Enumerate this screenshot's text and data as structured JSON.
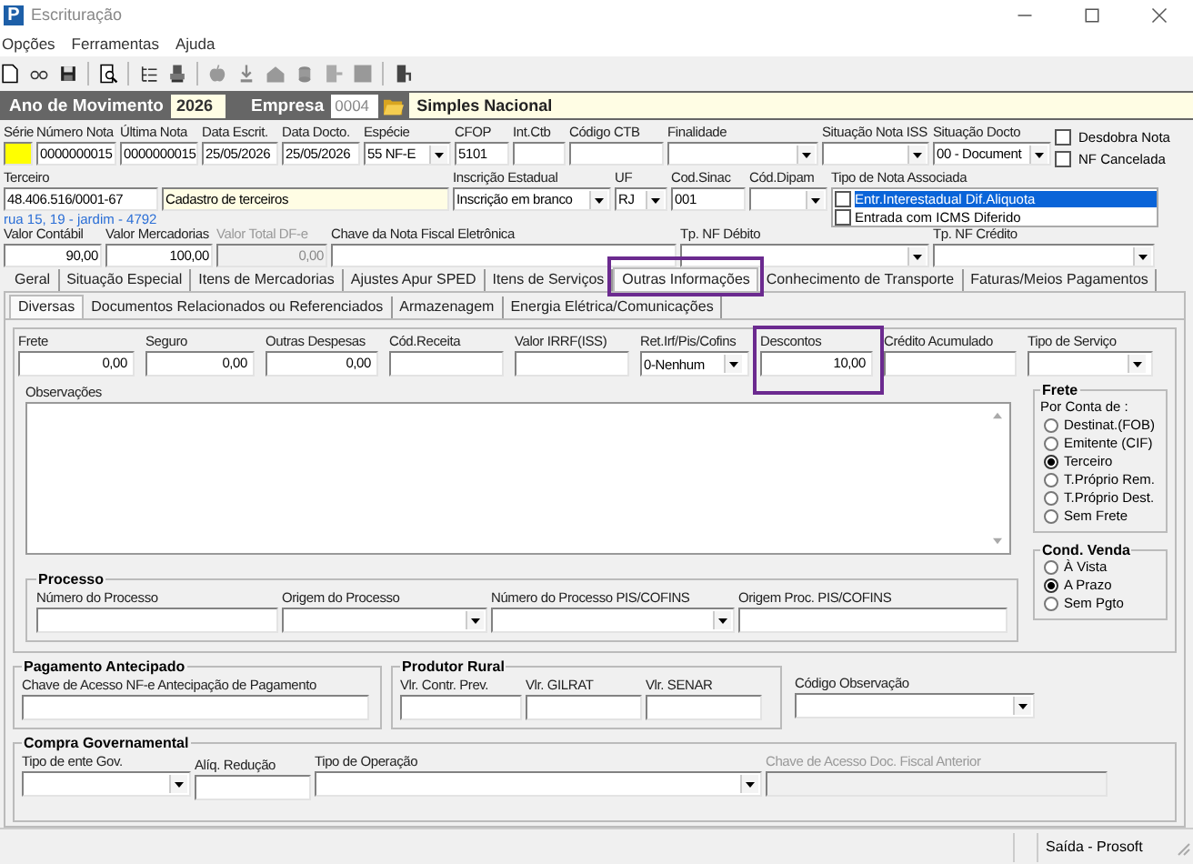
{
  "window": {
    "app_icon": "P",
    "title": "Escrituração"
  },
  "menu": [
    "Opções",
    "Ferramentas",
    "Ajuda"
  ],
  "year_bar": {
    "year_label": "Ano de Movimento",
    "year": "2026",
    "company_label": "Empresa",
    "company_code": "0004",
    "company_name": "Simples Nacional"
  },
  "header_row_1": [
    {
      "label": "Série",
      "kind": "swatch"
    },
    {
      "label": "Número Nota",
      "value": "0000000015",
      "kind": "text"
    },
    {
      "label": "Última Nota",
      "value": "0000000015",
      "kind": "text"
    },
    {
      "label": "Data Escrit.",
      "value": "25/05/2026",
      "kind": "text"
    },
    {
      "label": "Data Docto.",
      "value": "25/05/2026",
      "kind": "text"
    },
    {
      "label": "Espécie",
      "value": "55   NF-E",
      "kind": "dropdown"
    },
    {
      "label": "CFOP",
      "value": "5101",
      "kind": "text"
    },
    {
      "label": "Int.Ctb",
      "kind": "text"
    },
    {
      "label": "Código CTB",
      "kind": "text"
    },
    {
      "label": "Finalidade",
      "kind": "dropdown"
    },
    {
      "label": "Situação Nota ISS",
      "kind": "dropdown"
    },
    {
      "label": "Situação Docto",
      "value": "00 - Document",
      "kind": "dropdown"
    }
  ],
  "header_checks": [
    {
      "label": "Desdobra Nota",
      "checked": false
    },
    {
      "label": "NF Cancelada",
      "checked": false
    }
  ],
  "header_row_2": [
    {
      "label": "Terceiro",
      "value": "48.406.516/0001-67",
      "kind": "text"
    },
    {
      "value": "Cadastro de terceiros",
      "kind": "info"
    },
    {
      "label": "Inscrição Estadual",
      "value": "Inscrição em branco",
      "kind": "dropdown"
    },
    {
      "label": "UF",
      "value": "RJ",
      "kind": "dropdown"
    },
    {
      "label": "Cod.Sinac",
      "value": "001",
      "kind": "text"
    },
    {
      "label": "Cód.Dipam",
      "kind": "dropdown"
    }
  ],
  "associated_note_type": {
    "label": "Tipo de Nota Associada",
    "items": [
      {
        "label": "Entr.Interestadual Dif.Aliquota",
        "checked": false,
        "selected": true
      },
      {
        "label": "Entrada com ICMS Diferido",
        "checked": false,
        "selected": false
      }
    ]
  },
  "address": "rua 15, 19 - jardim - 4792",
  "header_row_3": [
    {
      "label": "Valor Contábil",
      "value": "90,00",
      "kind": "number",
      "disabled": false
    },
    {
      "label": "Valor Mercadorias",
      "value": "100,00",
      "kind": "number",
      "disabled": false
    },
    {
      "label": "Valor Total DF-e",
      "value": "0,00",
      "kind": "number",
      "disabled": true
    },
    {
      "label": "Chave da Nota Fiscal Eletrônica",
      "kind": "text",
      "disabled": false
    },
    {
      "label": "Tp. NF Débito",
      "kind": "dropdown",
      "disabled": false
    },
    {
      "label": "Tp. NF Crédito",
      "kind": "dropdown",
      "disabled": false
    }
  ],
  "tabs": [
    {
      "label": "Geral",
      "selected": false,
      "highlighted": false
    },
    {
      "label": "Situação Especial",
      "selected": false,
      "highlighted": false
    },
    {
      "label": "Itens de Mercadorias",
      "selected": false,
      "highlighted": false
    },
    {
      "label": "Ajustes Apur SPED",
      "selected": false,
      "highlighted": false
    },
    {
      "label": "Itens de Serviços",
      "selected": false,
      "highlighted": false
    },
    {
      "label": "Outras Informações",
      "selected": true,
      "highlighted": true
    },
    {
      "label": "Conhecimento de Transporte",
      "selected": false,
      "highlighted": false
    },
    {
      "label": "Faturas/Meios Pagamentos",
      "selected": false,
      "highlighted": false
    }
  ],
  "subtabs": [
    {
      "label": "Diversas",
      "selected": true
    },
    {
      "label": "Documentos Relacionados ou Referenciados",
      "selected": false
    },
    {
      "label": "Armazenagem",
      "selected": false
    },
    {
      "label": "Energia Elétrica/Comunicações",
      "selected": false
    }
  ],
  "diversas_fields": [
    {
      "label": "Frete",
      "value": "0,00",
      "kind": "number",
      "highlighted": false
    },
    {
      "label": "Seguro",
      "value": "0,00",
      "kind": "number",
      "highlighted": false
    },
    {
      "label": "Outras Despesas",
      "value": "0,00",
      "kind": "number",
      "highlighted": false
    },
    {
      "label": "Cód.Receita",
      "kind": "text",
      "highlighted": false
    },
    {
      "label": "Valor IRRF(ISS)",
      "kind": "text",
      "highlighted": false
    },
    {
      "label": "Ret.Irf/Pis/Cofins",
      "value": "0-Nenhum",
      "kind": "dropdown",
      "highlighted": false
    },
    {
      "label": "Descontos",
      "value": "10,00",
      "kind": "number",
      "highlighted": true
    },
    {
      "label": "Crédito Acumulado",
      "kind": "text",
      "highlighted": false
    },
    {
      "label": "Tipo de Serviço",
      "kind": "dropdown",
      "highlighted": false
    }
  ],
  "observations": {
    "label": "Observações"
  },
  "freight": {
    "title": "Frete",
    "caption": "Por Conta de :",
    "options": [
      {
        "label": "Destinat.(FOB)",
        "selected": false
      },
      {
        "label": "Emitente (CIF)",
        "selected": false
      },
      {
        "label": "Terceiro",
        "selected": true
      },
      {
        "label": "T.Próprio Rem.",
        "selected": false
      },
      {
        "label": "T.Próprio Dest.",
        "selected": false
      },
      {
        "label": "Sem Frete",
        "selected": false
      }
    ]
  },
  "sale_condition": {
    "title": "Cond. Venda",
    "options": [
      {
        "label": "À Vista",
        "selected": false
      },
      {
        "label": "A Prazo",
        "selected": true
      },
      {
        "label": "Sem Pgto",
        "selected": false
      }
    ]
  },
  "process": {
    "title": "Processo",
    "fields": [
      {
        "label": "Número do Processo",
        "kind": "text"
      },
      {
        "label": "Origem do Processo",
        "kind": "dropdown"
      },
      {
        "label": "Número do Processo PIS/COFINS",
        "kind": "dropdown"
      },
      {
        "label": "Origem Proc. PIS/COFINS",
        "kind": "text"
      }
    ]
  },
  "advance_payment": {
    "title": "Pagamento Antecipado",
    "fields": [
      {
        "label": "Chave de Acesso NF-e Antecipação de Pagamento",
        "kind": "text"
      }
    ]
  },
  "rural_producer": {
    "title": "Produtor Rural",
    "fields": [
      {
        "label": "Vlr. Contr. Prev.",
        "kind": "text"
      },
      {
        "label": "Vlr. GILRAT",
        "kind": "text"
      },
      {
        "label": "Vlr. SENAR",
        "kind": "text"
      }
    ]
  },
  "observation_code": {
    "label": "Código Observação",
    "kind": "dropdown"
  },
  "government_purchase": {
    "title": "Compra Governamental",
    "fields": [
      {
        "label": "Tipo de ente Gov.",
        "kind": "dropdown",
        "disabled": false
      },
      {
        "label": "Alíq. Redução",
        "kind": "text",
        "disabled": false
      },
      {
        "label": "Tipo de Operação",
        "kind": "dropdown",
        "disabled": false
      },
      {
        "label": "Chave de Acesso Doc. Fiscal Anterior",
        "kind": "text",
        "disabled": true
      }
    ]
  },
  "status_bar": {
    "text": "Saída - Prosoft"
  }
}
